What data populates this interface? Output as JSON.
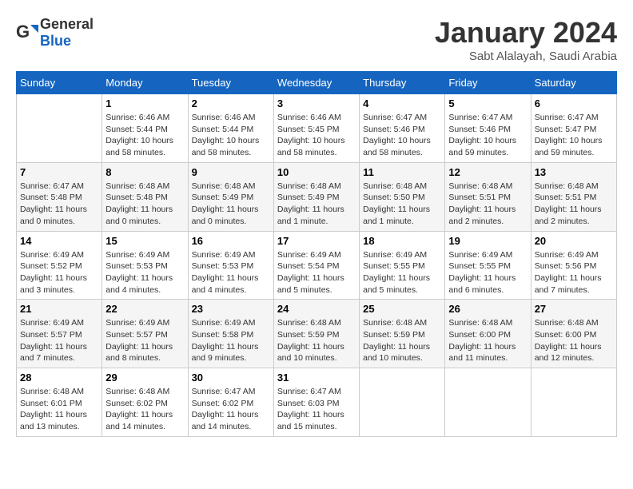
{
  "header": {
    "logo_general": "General",
    "logo_blue": "Blue",
    "month": "January 2024",
    "location": "Sabt Alalayah, Saudi Arabia"
  },
  "weekdays": [
    "Sunday",
    "Monday",
    "Tuesday",
    "Wednesday",
    "Thursday",
    "Friday",
    "Saturday"
  ],
  "weeks": [
    [
      {
        "day": "",
        "sunrise": "",
        "sunset": "",
        "daylight": ""
      },
      {
        "day": "1",
        "sunrise": "6:46 AM",
        "sunset": "5:44 PM",
        "daylight": "10 hours and 58 minutes."
      },
      {
        "day": "2",
        "sunrise": "6:46 AM",
        "sunset": "5:44 PM",
        "daylight": "10 hours and 58 minutes."
      },
      {
        "day": "3",
        "sunrise": "6:46 AM",
        "sunset": "5:45 PM",
        "daylight": "10 hours and 58 minutes."
      },
      {
        "day": "4",
        "sunrise": "6:47 AM",
        "sunset": "5:46 PM",
        "daylight": "10 hours and 58 minutes."
      },
      {
        "day": "5",
        "sunrise": "6:47 AM",
        "sunset": "5:46 PM",
        "daylight": "10 hours and 59 minutes."
      },
      {
        "day": "6",
        "sunrise": "6:47 AM",
        "sunset": "5:47 PM",
        "daylight": "10 hours and 59 minutes."
      }
    ],
    [
      {
        "day": "7",
        "sunrise": "6:47 AM",
        "sunset": "5:48 PM",
        "daylight": "11 hours and 0 minutes."
      },
      {
        "day": "8",
        "sunrise": "6:48 AM",
        "sunset": "5:48 PM",
        "daylight": "11 hours and 0 minutes."
      },
      {
        "day": "9",
        "sunrise": "6:48 AM",
        "sunset": "5:49 PM",
        "daylight": "11 hours and 0 minutes."
      },
      {
        "day": "10",
        "sunrise": "6:48 AM",
        "sunset": "5:49 PM",
        "daylight": "11 hours and 1 minute."
      },
      {
        "day": "11",
        "sunrise": "6:48 AM",
        "sunset": "5:50 PM",
        "daylight": "11 hours and 1 minute."
      },
      {
        "day": "12",
        "sunrise": "6:48 AM",
        "sunset": "5:51 PM",
        "daylight": "11 hours and 2 minutes."
      },
      {
        "day": "13",
        "sunrise": "6:48 AM",
        "sunset": "5:51 PM",
        "daylight": "11 hours and 2 minutes."
      }
    ],
    [
      {
        "day": "14",
        "sunrise": "6:49 AM",
        "sunset": "5:52 PM",
        "daylight": "11 hours and 3 minutes."
      },
      {
        "day": "15",
        "sunrise": "6:49 AM",
        "sunset": "5:53 PM",
        "daylight": "11 hours and 4 minutes."
      },
      {
        "day": "16",
        "sunrise": "6:49 AM",
        "sunset": "5:53 PM",
        "daylight": "11 hours and 4 minutes."
      },
      {
        "day": "17",
        "sunrise": "6:49 AM",
        "sunset": "5:54 PM",
        "daylight": "11 hours and 5 minutes."
      },
      {
        "day": "18",
        "sunrise": "6:49 AM",
        "sunset": "5:55 PM",
        "daylight": "11 hours and 5 minutes."
      },
      {
        "day": "19",
        "sunrise": "6:49 AM",
        "sunset": "5:55 PM",
        "daylight": "11 hours and 6 minutes."
      },
      {
        "day": "20",
        "sunrise": "6:49 AM",
        "sunset": "5:56 PM",
        "daylight": "11 hours and 7 minutes."
      }
    ],
    [
      {
        "day": "21",
        "sunrise": "6:49 AM",
        "sunset": "5:57 PM",
        "daylight": "11 hours and 7 minutes."
      },
      {
        "day": "22",
        "sunrise": "6:49 AM",
        "sunset": "5:57 PM",
        "daylight": "11 hours and 8 minutes."
      },
      {
        "day": "23",
        "sunrise": "6:49 AM",
        "sunset": "5:58 PM",
        "daylight": "11 hours and 9 minutes."
      },
      {
        "day": "24",
        "sunrise": "6:48 AM",
        "sunset": "5:59 PM",
        "daylight": "11 hours and 10 minutes."
      },
      {
        "day": "25",
        "sunrise": "6:48 AM",
        "sunset": "5:59 PM",
        "daylight": "11 hours and 10 minutes."
      },
      {
        "day": "26",
        "sunrise": "6:48 AM",
        "sunset": "6:00 PM",
        "daylight": "11 hours and 11 minutes."
      },
      {
        "day": "27",
        "sunrise": "6:48 AM",
        "sunset": "6:00 PM",
        "daylight": "11 hours and 12 minutes."
      }
    ],
    [
      {
        "day": "28",
        "sunrise": "6:48 AM",
        "sunset": "6:01 PM",
        "daylight": "11 hours and 13 minutes."
      },
      {
        "day": "29",
        "sunrise": "6:48 AM",
        "sunset": "6:02 PM",
        "daylight": "11 hours and 14 minutes."
      },
      {
        "day": "30",
        "sunrise": "6:47 AM",
        "sunset": "6:02 PM",
        "daylight": "11 hours and 14 minutes."
      },
      {
        "day": "31",
        "sunrise": "6:47 AM",
        "sunset": "6:03 PM",
        "daylight": "11 hours and 15 minutes."
      },
      {
        "day": "",
        "sunrise": "",
        "sunset": "",
        "daylight": ""
      },
      {
        "day": "",
        "sunrise": "",
        "sunset": "",
        "daylight": ""
      },
      {
        "day": "",
        "sunrise": "",
        "sunset": "",
        "daylight": ""
      }
    ]
  ],
  "labels": {
    "sunrise_prefix": "Sunrise: ",
    "sunset_prefix": "Sunset: ",
    "daylight_prefix": "Daylight: "
  }
}
